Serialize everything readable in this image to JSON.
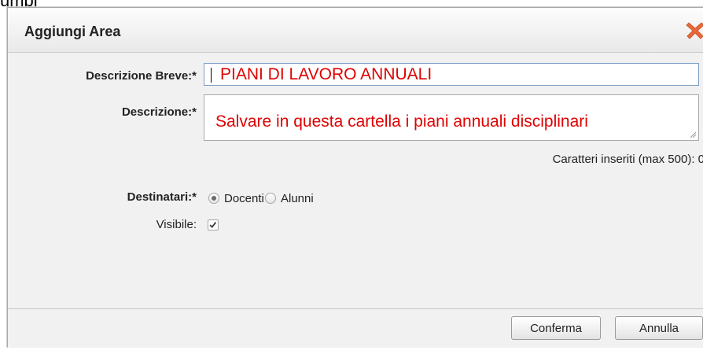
{
  "background_fragment": "umpi",
  "dialog": {
    "title": "Aggiungi Area",
    "close_icon": "close-x-icon",
    "close_color": "#e8693a"
  },
  "form": {
    "short_description": {
      "label": "Descrizione Breve:*",
      "value": "PIANI DI LAVORO ANNUALI"
    },
    "description": {
      "label": "Descrizione:*",
      "value": "Salvare in questa cartella i piani annuali disciplinari"
    },
    "char_counter": "Caratteri inseriti (max 500): 0",
    "recipients": {
      "label": "Destinatari:*",
      "options": [
        {
          "label": "Docenti",
          "selected": true
        },
        {
          "label": "Alunni",
          "selected": false
        }
      ]
    },
    "visible": {
      "label": "Visibile:",
      "checked": true
    }
  },
  "footer": {
    "confirm_label": "Conferma",
    "cancel_label": "Annulla"
  },
  "colors": {
    "input_text": "#e00000",
    "focus_border": "#7a9cc6"
  }
}
